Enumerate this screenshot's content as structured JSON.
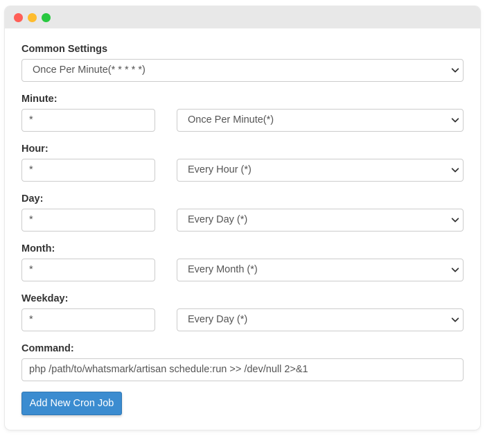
{
  "window": {
    "controls": {
      "close": "close",
      "minimize": "minimize",
      "zoom": "zoom"
    }
  },
  "common_settings": {
    "label": "Common Settings",
    "selected": "Once Per Minute(* * * * *)"
  },
  "minute": {
    "label": "Minute:",
    "value": "*",
    "selected": "Once Per Minute(*)"
  },
  "hour": {
    "label": "Hour:",
    "value": "*",
    "selected": "Every Hour (*)"
  },
  "day": {
    "label": "Day:",
    "value": "*",
    "selected": "Every Day (*)"
  },
  "month": {
    "label": "Month:",
    "value": "*",
    "selected": "Every Month (*)"
  },
  "weekday": {
    "label": "Weekday:",
    "value": "*",
    "selected": "Every Day (*)"
  },
  "command": {
    "label": "Command:",
    "value": "php /path/to/whatsmark/artisan schedule:run >> /dev/null 2>&1"
  },
  "actions": {
    "add_label": "Add New Cron Job"
  },
  "colors": {
    "accent": "#3b8cd0",
    "close": "#ff5f57",
    "minimize": "#febc2e",
    "zoom": "#28c840"
  },
  "icons": {
    "select_arrow": "chevron-down-icon"
  }
}
